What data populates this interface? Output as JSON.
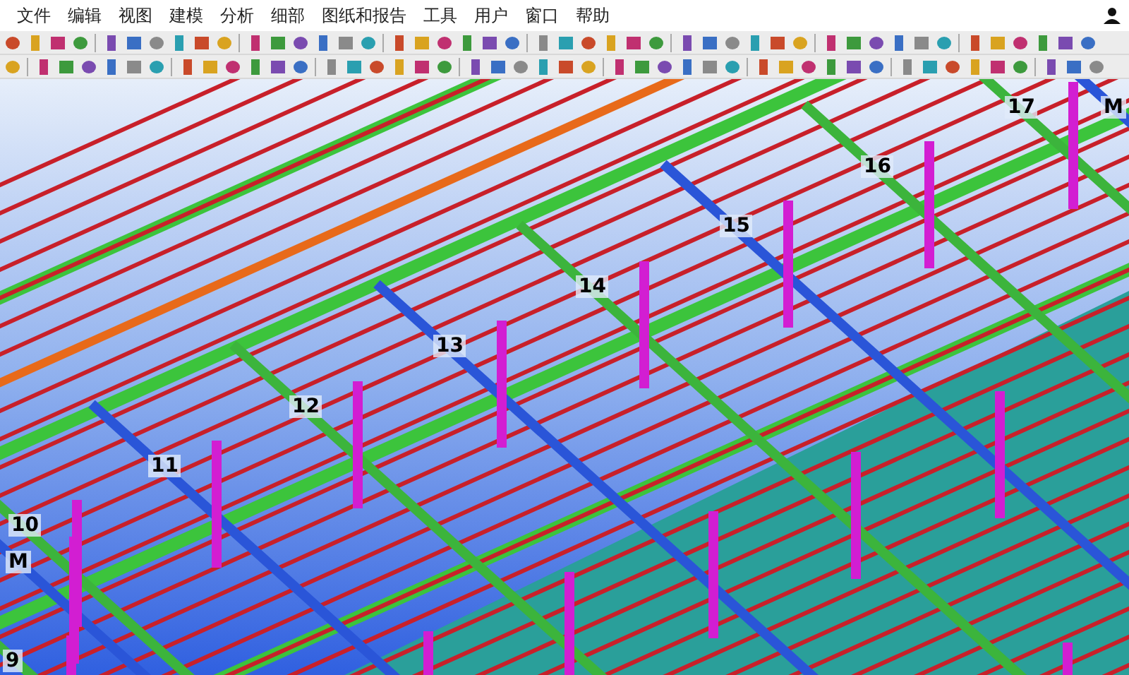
{
  "menu": [
    "文件",
    "编辑",
    "视图",
    "建模",
    "分析",
    "细部",
    "图纸和报告",
    "工具",
    "用户",
    "窗口",
    "帮助"
  ],
  "viewport": {
    "grid_labels": [
      {
        "text": "17"
      },
      {
        "text": "M"
      },
      {
        "text": "16"
      },
      {
        "text": "15"
      },
      {
        "text": "14"
      },
      {
        "text": "13"
      },
      {
        "text": "12"
      },
      {
        "text": "11"
      },
      {
        "text": "10"
      },
      {
        "text": "M"
      },
      {
        "text": "9"
      }
    ]
  }
}
